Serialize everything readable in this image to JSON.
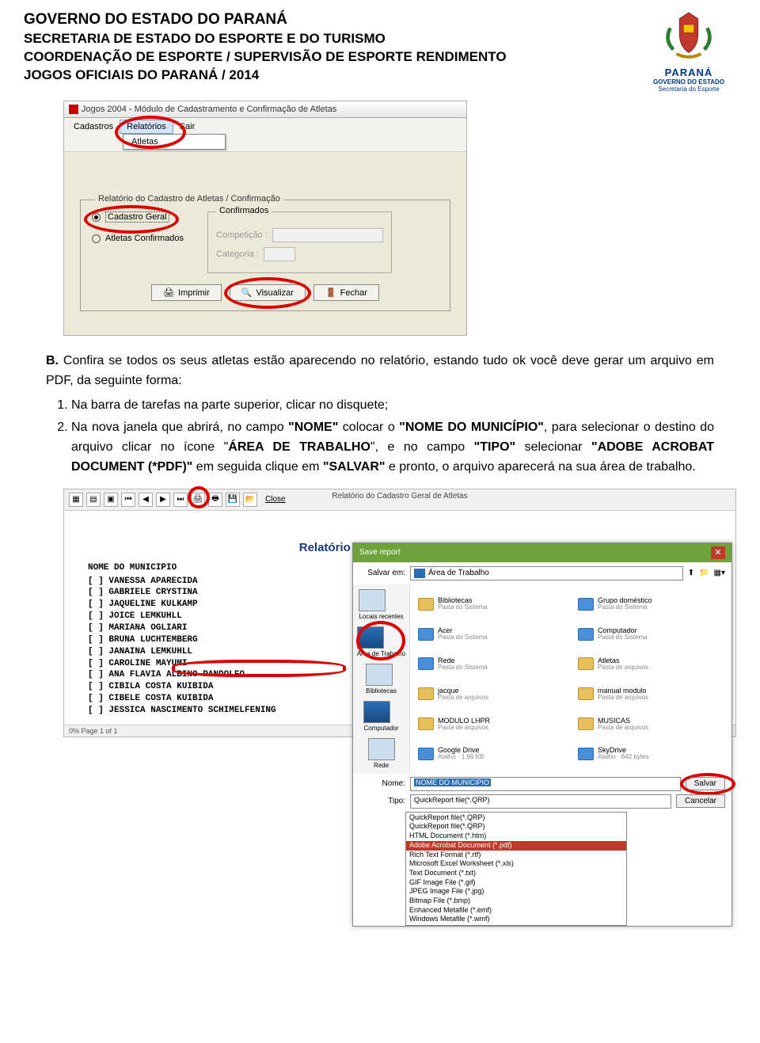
{
  "header": {
    "line1": "GOVERNO DO ESTADO DO PARANÁ",
    "line2": "SECRETARIA DE ESTADO DO ESPORTE E DO TURISMO",
    "line3": "COORDENAÇÃO DE ESPORTE / SUPERVISÃO DE ESPORTE RENDIMENTO",
    "line4": "JOGOS OFICIAIS DO PARANÁ / 2014"
  },
  "logo": {
    "title": "PARANÁ",
    "sub1": "GOVERNO DO ESTADO",
    "sub2": "Secretaria do Esporte"
  },
  "shot1": {
    "title": "Jogos 2004 - Módulo de Cadastramento e Confirmação de Atletas",
    "menu": {
      "cadastros": "Cadastros",
      "relatorios": "Relatórios",
      "sair": "Sair",
      "atletas": "Atletas"
    },
    "panel_title": "Relatório do Cadastro de Atletas / Confirmação",
    "radio1": "Cadastro Geral",
    "radio2": "Atletas Confirmados",
    "conf_title": "Confirmados",
    "comp_label": "Competição :",
    "cat_label": "Categoria :",
    "btn_imprimir": "Imprimir",
    "btn_visualizar": "Visualizar",
    "btn_fechar": "Fechar"
  },
  "instructions": {
    "lead_b": "B.",
    "lead": "Confira se todos os seus atletas estão aparecendo no relatório, estando tudo ok você deve gerar um arquivo em PDF, da seguinte forma:",
    "li1": "Na barra de tarefas na parte superior, clicar no disquete;",
    "li2": "Na nova janela que abrirá, no campo \"NOME\" colocar o \"NOME DO MUNICÍPIO\", para selecionar o destino do arquivo clicar no ícone \"ÁREA DE TRABALHO\", e no campo \"TIPO\" selecionar \"ADOBE ACROBAT DOCUMENT (*PDF)\" em seguida clique em \"SALVAR\" e pronto, o arquivo aparecerá na sua área de trabalho."
  },
  "shot2": {
    "toolbar_title": "Relatório do Cadastro Geral de Atletas",
    "close_btn": "Close",
    "report_title": "Relatório do Cadastro Geral de Atletas",
    "list_header": "NOME DO MUNICIPIO",
    "athletes": [
      "[ ] VANESSA APARECIDA",
      "[ ] GABRIELE CRYSTINA",
      "[ ] JAQUELINE KULKAMP",
      "[ ] JOICE LEMKUHLL",
      "[ ] MARIANA OGLIARI",
      "[ ] BRUNA LUCHTEMBERG",
      "[ ] JANAINA LEMKUHLL",
      "[ ] CAROLINE MAYUMI",
      "[ ] ANA FLAVIA ALBINO PANDOLFO",
      "[ ] CIBILA COSTA KUIBIDA",
      "[ ] CIBELE COSTA KUIBIDA",
      "[ ] JESSICA NASCIMENTO SCHIMELFENING"
    ],
    "save_dialog": {
      "title": "Save report",
      "salvar_em": "Salvar em:",
      "location": "Área de Trabalho",
      "side": {
        "recent": "Locais recentes",
        "desktop": "Área de Trabalho",
        "libs": "Bibliotecas",
        "computer": "Computador",
        "network": "Rede"
      },
      "items": [
        {
          "n": "Bibliotecas",
          "s": "Pasta do Sistema"
        },
        {
          "n": "Grupo doméstico",
          "s": "Pasta do Sistema"
        },
        {
          "n": "Acer",
          "s": "Pasta do Sistema"
        },
        {
          "n": "Computador",
          "s": "Pasta do Sistema"
        },
        {
          "n": "Rede",
          "s": "Pasta do Sistema"
        },
        {
          "n": "Atletas",
          "s": "Pasta de arquivos"
        },
        {
          "n": "jacque",
          "s": "Pasta de arquivos"
        },
        {
          "n": "manual modulo",
          "s": "Pasta de arquivos"
        },
        {
          "n": "MODULO LHPR",
          "s": "Pasta de arquivos"
        },
        {
          "n": "MUSICAS",
          "s": "Pasta de arquivos"
        },
        {
          "n": "Google Drive",
          "s": "Atalho · 1.66 KB"
        },
        {
          "n": "SkyDrive",
          "s": "Atalho · 642 bytes"
        }
      ],
      "nome_label": "Nome:",
      "nome_value": "NOME DO MUNICIPIO",
      "tipo_label": "Tipo:",
      "tipo_value": "QuickReport file(*.QRP)",
      "salvar_btn": "Salvar",
      "cancelar_btn": "Cancelar",
      "types": [
        "QuickReport file(*.QRP)",
        "QuickReport file(*.QRP)",
        "HTML Document (*.htm)",
        "Adobe Acrobat Document (*.pdf)",
        "Rich Text Format (*.rtf)",
        "Microsoft Excel Worksheet (*.xls)",
        "Text Document (*.txt)",
        "GIF Image File (*.gif)",
        "JPEG Image File (*.jpg)",
        "Bitmap File (*.bmp)",
        "Enhanced Metafile (*.emf)",
        "Windows Metafile (*.wmf)"
      ]
    },
    "footer": "0%  Page 1 of 1"
  }
}
